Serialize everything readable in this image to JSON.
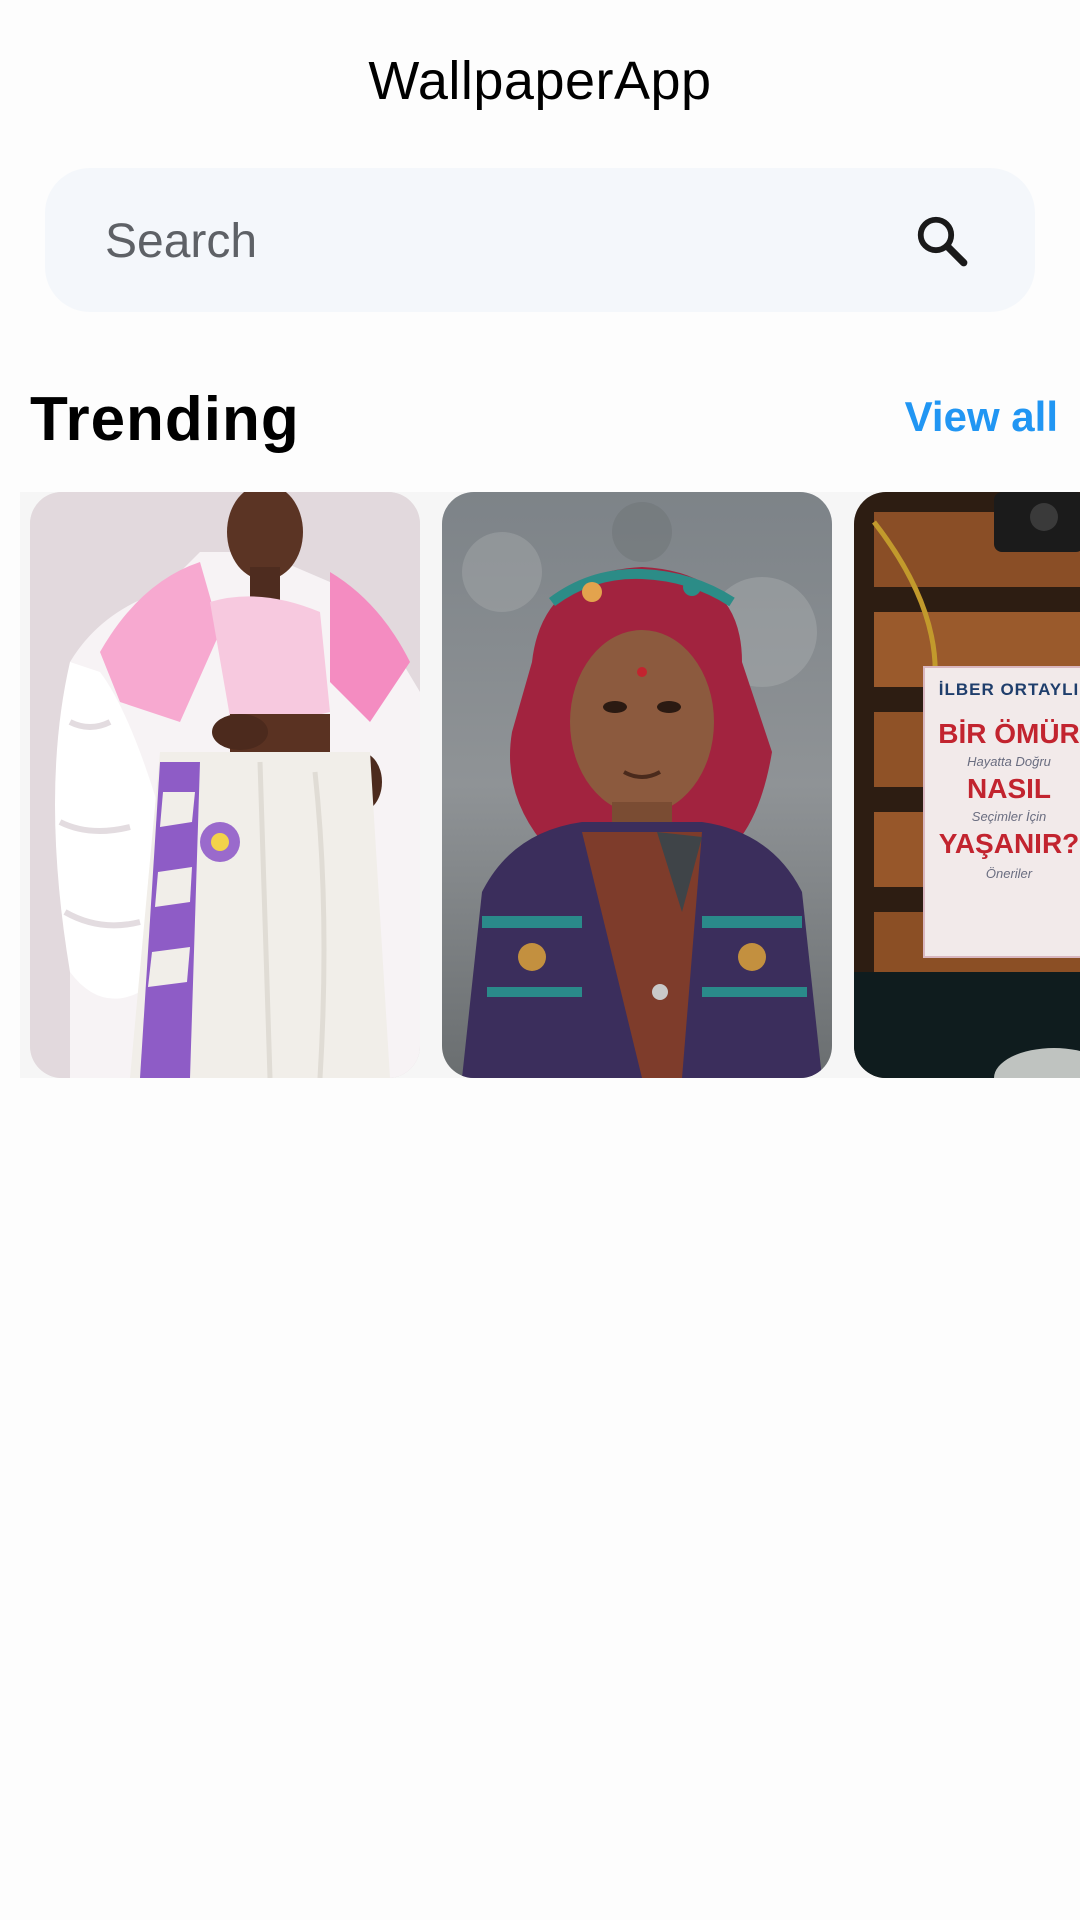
{
  "app": {
    "title": "WallpaperApp"
  },
  "search": {
    "placeholder": "Search",
    "value": "",
    "icon": "search-icon"
  },
  "trending": {
    "title": "Trending",
    "view_all_label": "View all",
    "accent_color": "#2196F3",
    "items": [
      {
        "description": "woman in pink and white jacket and white patterned pants"
      },
      {
        "description": "elderly woman wearing red headscarf and patterned cardigan"
      },
      {
        "description": "book on wooden shelf with camera",
        "author": "İLBER ORTAYLI",
        "title_line1": "BİR ÖMÜR",
        "title_line2": "NASIL",
        "title_line3": "YAŞANIR?",
        "subtitle1": "Hayatta Doğru",
        "subtitle2": "Seçimler İçin",
        "subtitle3": "Öneriler"
      }
    ]
  },
  "colors": {
    "background": "#FDFDFD",
    "search_background": "#F4F7FB",
    "accent": "#2196F3"
  }
}
